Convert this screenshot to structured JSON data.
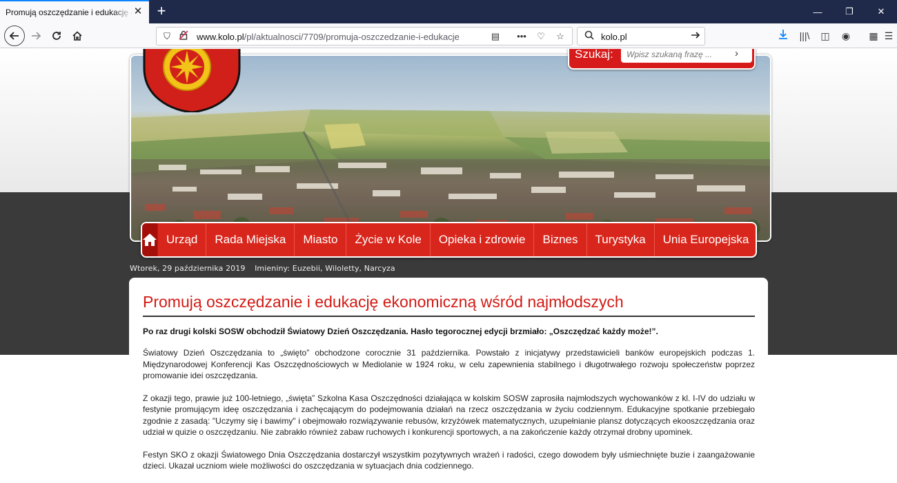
{
  "browser": {
    "tab_title": "Promują oszczędzanie i edukację ekonomiczną wśród najmłodszych",
    "url_domain": "www.kolo.pl",
    "url_path": "/pl/aktualnosci/7709/promuja-oszczedzanie-i-edukacje",
    "search_value": "kolo.pl"
  },
  "site": {
    "search_label": "Szukaj:",
    "search_placeholder": "Wpisz szukaną frazę ...",
    "menu": [
      "Urząd",
      "Rada Miejska",
      "Miasto",
      "Życie w Kole",
      "Opieka i zdrowie",
      "Biznes",
      "Turystyka",
      "Unia Europejska"
    ],
    "date": "Wtorek, 29 października 2019",
    "nameday": "Imieniny: Euzebii, Wiloletty, Narcyza"
  },
  "article": {
    "title": "Promują oszczędzanie i edukację ekonomiczną wśród najmłodszych",
    "lead": "Po raz drugi kolski SOSW obchodził Światowy Dzień Oszczędzania. Hasło tegorocznej edycji brzmiało: „Oszczędzać każdy może!”.",
    "p1": "Światowy Dzień Oszczędzania to „święto” obchodzone corocznie 31 października. Powstało z inicjatywy przedstawicieli banków europejskich  podczas 1. Międzynarodowej Konferencji Kas Oszczędnościowych w Mediolanie w 1924 roku, w celu zapewnienia stabilnego i długotrwałego rozwoju społeczeństw poprzez promowanie idei oszczędzania.",
    "p2": "Z okazji tego, prawie już 100-letniego, „święta” Szkolna Kasa Oszczędności działająca w kolskim SOSW zaprosiła najmłodszych wychowanków z kl. I-IV do udziału w festynie promującym ideę oszczędzania i zachęcającym do podejmowania działań na rzecz oszczędzania w życiu codziennym.  Edukacyjne spotkanie przebiegało zgodnie z zasadą: \"Uczymy się i bawimy\" i obejmowało rozwiązywanie rebusów, krzyżówek matematycznych, uzupełnianie plansz dotyczących ekooszczędzania oraz udział w quizie o oszczędzaniu. Nie zabrakło również zabaw ruchowych i konkurencji sportowych, a na zakończenie każdy otrzymał drobny upominek.",
    "p3": "Festyn SKO z okazji Światowego Dnia Oszczędzania dostarczył wszystkim pozytywnych wrażeń i radości, czego dowodem były uśmiechnięte buzie i zaangażowanie dzieci. Ukazał uczniom wiele możliwości do oszczędzania w sytuacjach dnia codziennego."
  }
}
